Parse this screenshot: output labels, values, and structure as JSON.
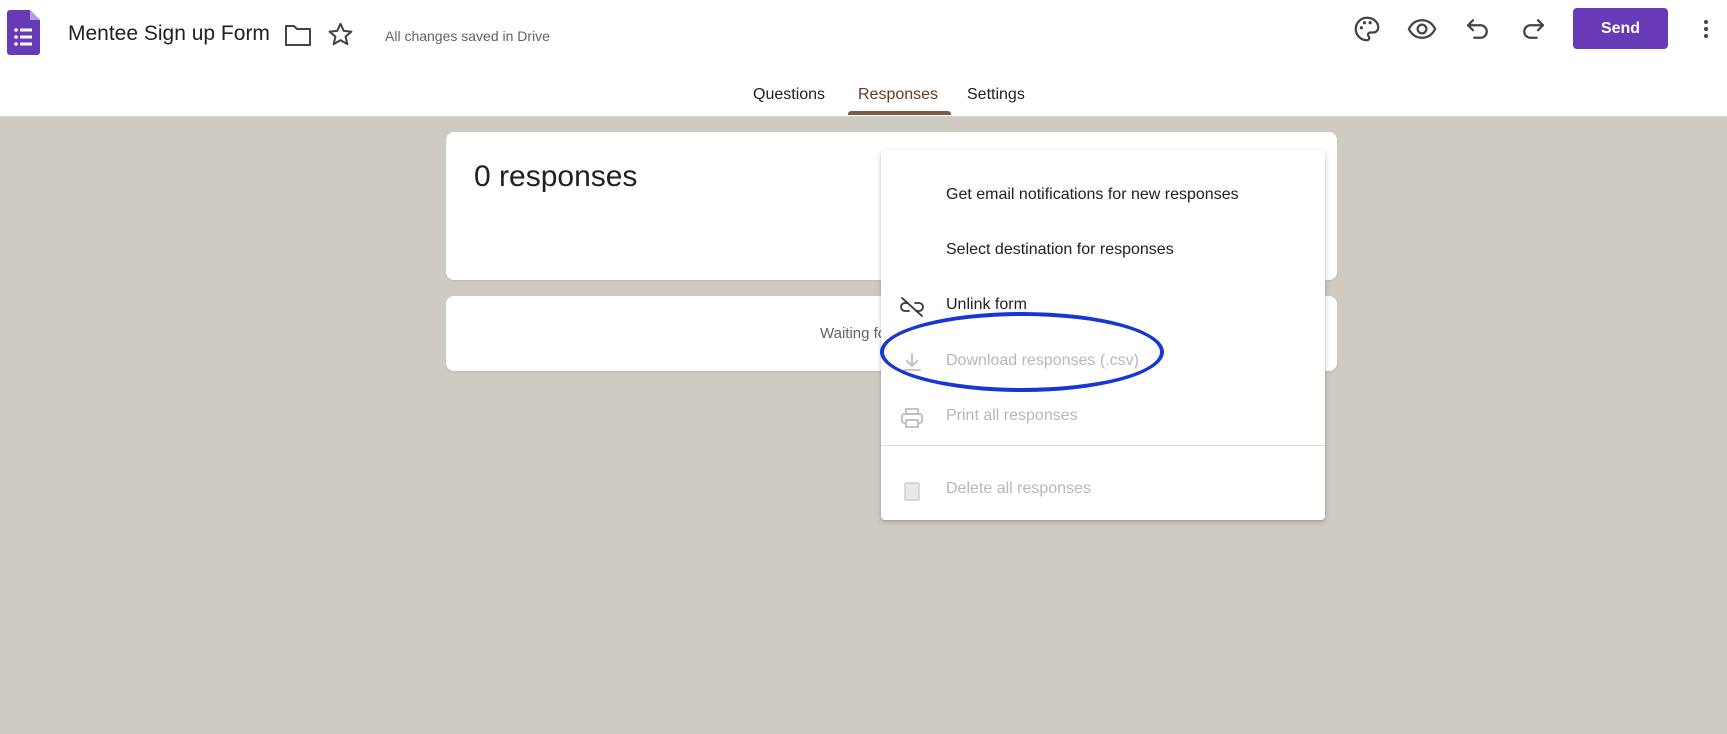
{
  "header": {
    "app_icon": "forms-app-icon",
    "title": "Mentee Sign up Form",
    "folder_icon": "folder-icon",
    "star_icon": "star-icon",
    "save_status": "All changes saved in Drive",
    "send_label": "Send",
    "accent_color": "#673ab7"
  },
  "tabs": [
    {
      "label": "Questions"
    },
    {
      "label": "Responses",
      "selected": true
    },
    {
      "label": "Settings"
    }
  ],
  "summary": {
    "responses_title": "0 responses",
    "waiting_text": "Waiting for responses"
  },
  "menu": {
    "items": [
      {
        "label": "Get email notifications for new responses",
        "icon": "",
        "enabled": true
      },
      {
        "label": "Select destination for responses",
        "icon": "",
        "enabled": true
      },
      {
        "label": "Unlink form",
        "icon": "unlink-icon",
        "enabled": true
      },
      {
        "label": "Download responses (.csv)",
        "icon": "download-icon",
        "enabled": false
      },
      {
        "label": "Print all responses",
        "icon": "print-icon",
        "enabled": false
      },
      {
        "label": "Delete all responses",
        "icon": "trash-icon",
        "enabled": false
      }
    ]
  },
  "annotation_color": "#1736d6"
}
